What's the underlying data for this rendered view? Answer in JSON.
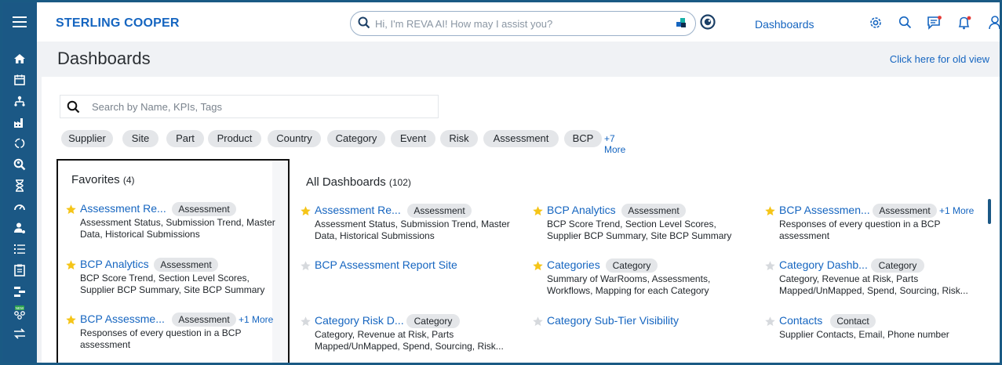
{
  "app": {
    "brand": "STERLING COOPER"
  },
  "topbar": {
    "search_placeholder": "Hi, I'm REVA AI! How may I assist you?",
    "nav_dashboards": "Dashboards"
  },
  "page": {
    "title": "Dashboards",
    "old_view_link": "Click here for old view",
    "search_placeholder": "Search by Name, KPIs, Tags"
  },
  "filters": {
    "chips": [
      "Supplier",
      "Site",
      "Part",
      "Product",
      "Country",
      "Category",
      "Event",
      "Risk",
      "Assessment",
      "BCP"
    ],
    "more": "+7 More"
  },
  "favorites": {
    "title": "Favorites",
    "count": "(4)",
    "items": [
      {
        "name": "Assessment Re...",
        "tag": "Assessment",
        "starred": true,
        "desc1": "Assessment Status, Submission Trend, Master",
        "desc2": "Data, Historical Submissions"
      },
      {
        "name": "BCP Analytics",
        "tag": "Assessment",
        "starred": true,
        "desc1": "BCP Score Trend, Section Level Scores,",
        "desc2": "Supplier BCP Summary, Site BCP Summary"
      },
      {
        "name": "BCP Assessme...",
        "tag": "Assessment",
        "more": "+1 More",
        "starred": true,
        "desc1": "Responses of every question in a BCP",
        "desc2": "assessment"
      }
    ]
  },
  "all_dashboards": {
    "title": "All Dashboards",
    "count": "(102)",
    "items": [
      {
        "name": "Assessment Re...",
        "tag": "Assessment",
        "starred": true,
        "desc1": "Assessment Status, Submission Trend, Master",
        "desc2": "Data, Historical Submissions"
      },
      {
        "name": "BCP Analytics",
        "tag": "Assessment",
        "starred": true,
        "desc1": "BCP Score Trend, Section Level Scores,",
        "desc2": "Supplier BCP Summary, Site BCP Summary"
      },
      {
        "name": "BCP Assessmen...",
        "tag": "Assessment",
        "more": "+1 More",
        "starred": true,
        "desc1": "Responses of every question in a BCP",
        "desc2": "assessment"
      },
      {
        "name": "BCP Assessment Report Site",
        "starred": false,
        "desc1": "",
        "desc2": ""
      },
      {
        "name": "Categories",
        "tag": "Category",
        "starred": true,
        "desc1": "Summary of WarRooms, Assessments,",
        "desc2": "Workflows, Mapping for each Category"
      },
      {
        "name": "Category Dashb...",
        "tag": "Category",
        "starred": false,
        "desc1": "Category, Revenue at Risk, Parts",
        "desc2": "Mapped/UnMapped, Spend, Sourcing, Risk..."
      },
      {
        "name": "Category Risk D...",
        "tag": "Category",
        "starred": false,
        "desc1": "Category, Revenue at Risk, Parts",
        "desc2": "Mapped/UnMapped, Spend, Sourcing, Risk..."
      },
      {
        "name": "Category Sub-Tier Visibility",
        "starred": false,
        "desc1": "",
        "desc2": ""
      },
      {
        "name": "Contacts",
        "tag": "Contact",
        "starred": false,
        "desc1": "Supplier Contacts, Email, Phone number",
        "desc2": ""
      }
    ]
  },
  "colors": {
    "accent": "#1565c0",
    "sidebar": "#1b5885",
    "star_on": "#f5c518",
    "star_off": "#d6d9dd"
  }
}
